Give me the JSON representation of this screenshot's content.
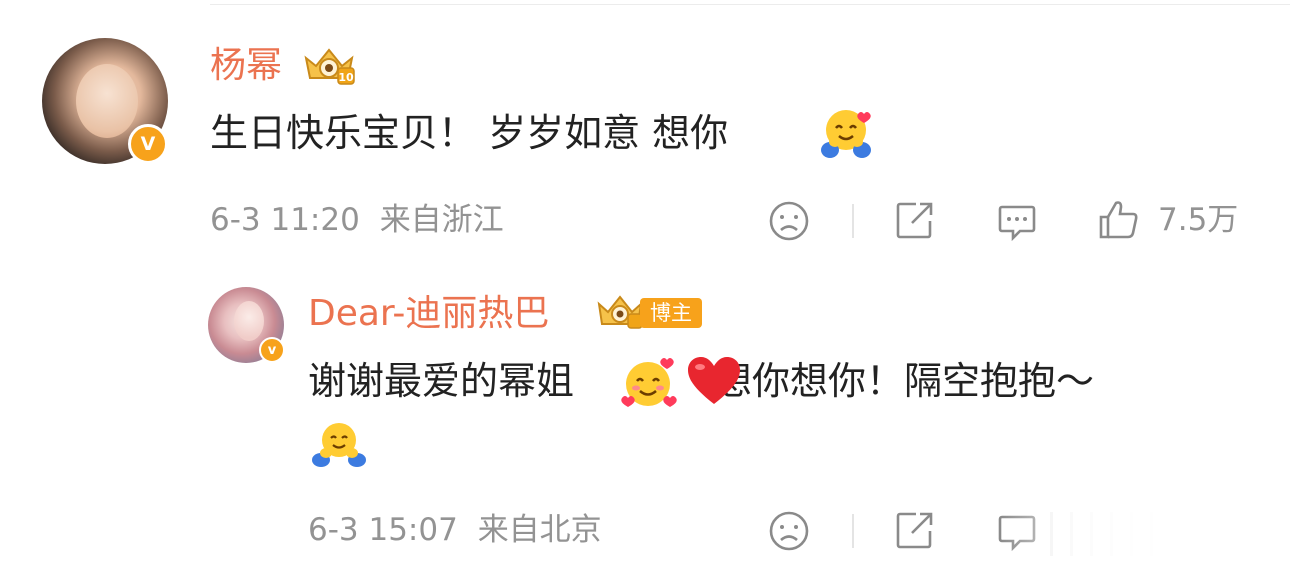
{
  "comment": {
    "author": "杨幂",
    "text": "生日快乐宝贝！ 岁岁如意 想你",
    "emoji_end": "hug-emoji",
    "timestamp": "6-3 11:20",
    "location": "来自浙江",
    "likes": "7.5万",
    "verified_badge": "V"
  },
  "reply": {
    "author": "Dear-迪丽热巴",
    "tag": "博主",
    "text_part1": "谢谢最爱的幂姐",
    "text_part2": "想你想你！隔空抱抱～",
    "emojis": [
      "smiling-hearts-emoji",
      "red-heart-emoji",
      "hug-emoji"
    ],
    "timestamp": "6-3 15:07",
    "location": "来自北京",
    "verified_badge": "v"
  },
  "colors": {
    "name": "#eb7350",
    "badge": "#f7a21b",
    "meta": "#939393",
    "text": "#222222"
  }
}
